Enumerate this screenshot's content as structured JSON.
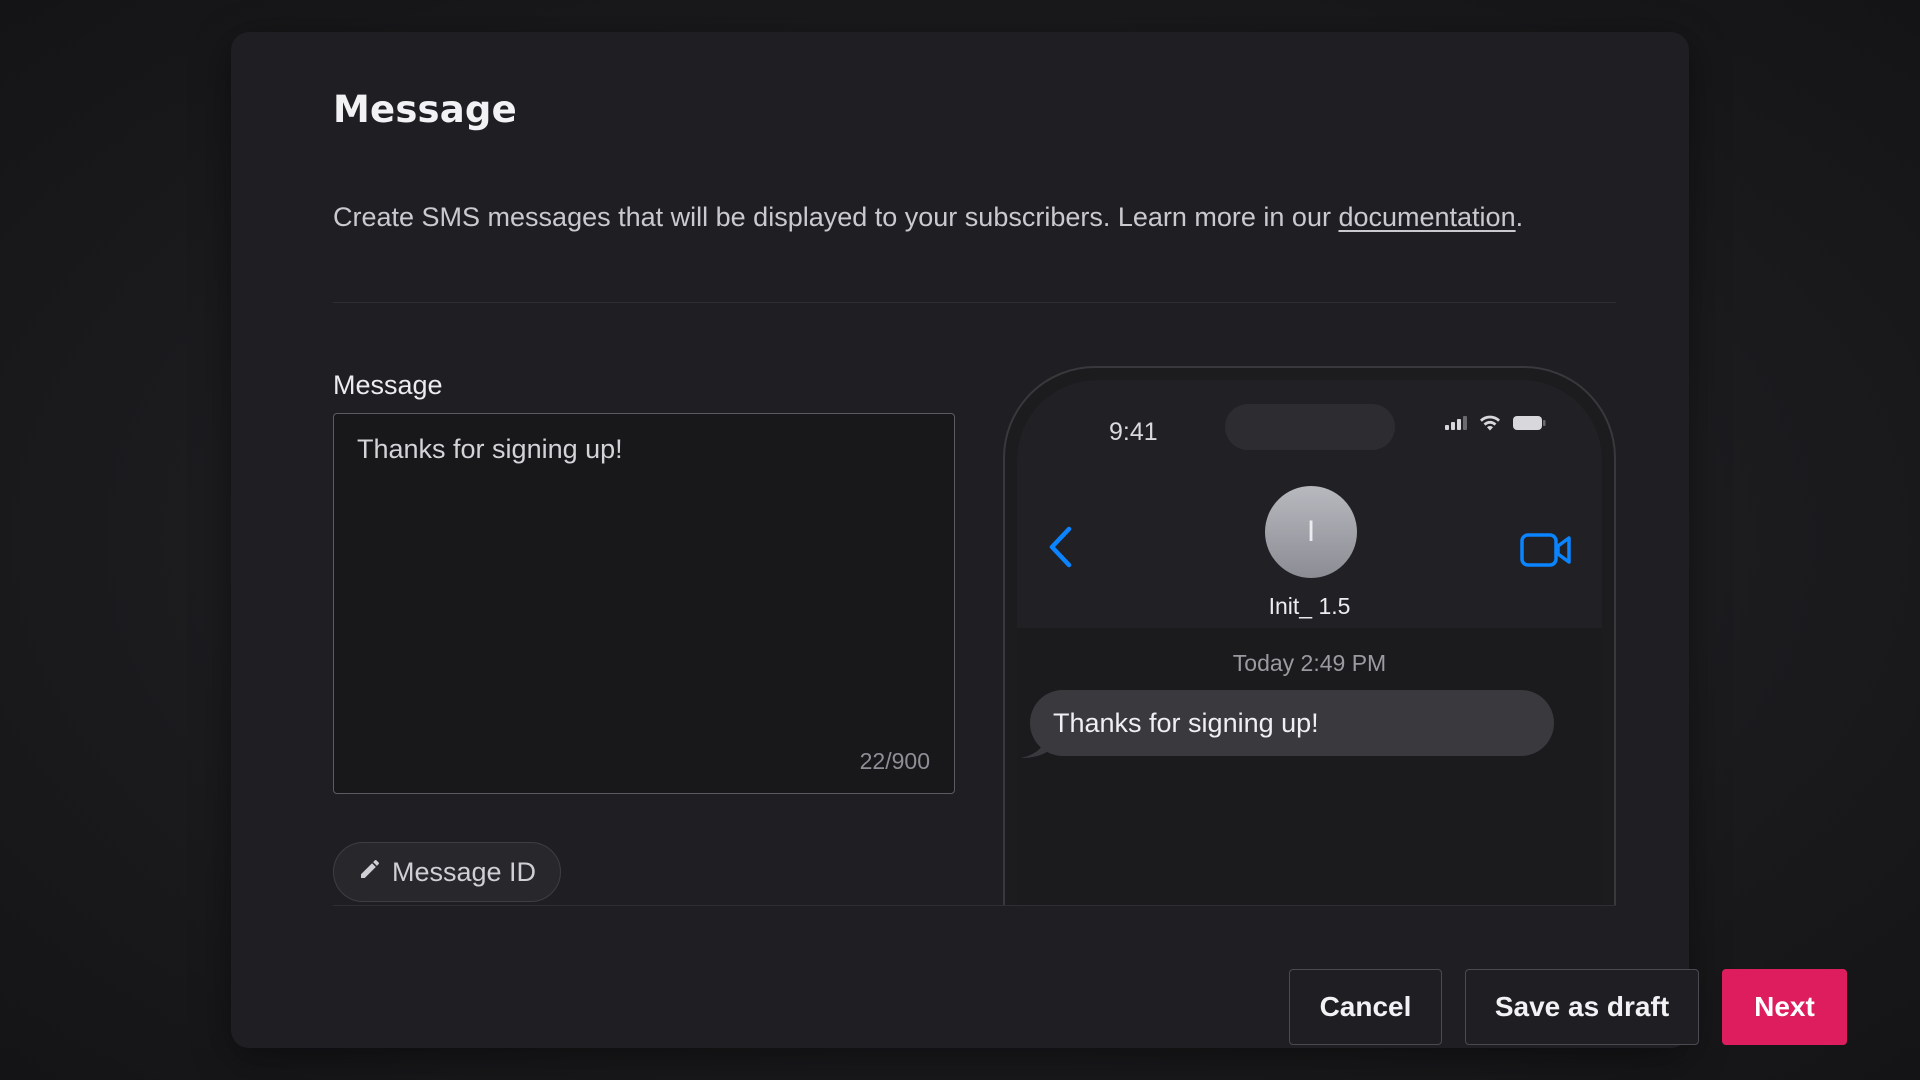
{
  "modal": {
    "title": "Message",
    "description": "Create SMS messages that will be displayed to your subscribers. Learn more in our ",
    "description_link": "documentation",
    "description_end": "."
  },
  "form": {
    "label": "Message",
    "message_value": "Thanks for signing up!",
    "char_counter": "22/900",
    "message_id_button": "Message ID"
  },
  "phone_preview": {
    "status_time": "9:41",
    "contact_initial": "I",
    "contact_name": "Init_ 1.5",
    "timestamp": "Today 2:49 PM",
    "bubble_text": "Thanks for signing up!",
    "accent_color": "#0a84ff"
  },
  "footer": {
    "cancel_label": "Cancel",
    "draft_label": "Save as draft",
    "next_label": "Next",
    "next_color": "#dd1d5e"
  }
}
